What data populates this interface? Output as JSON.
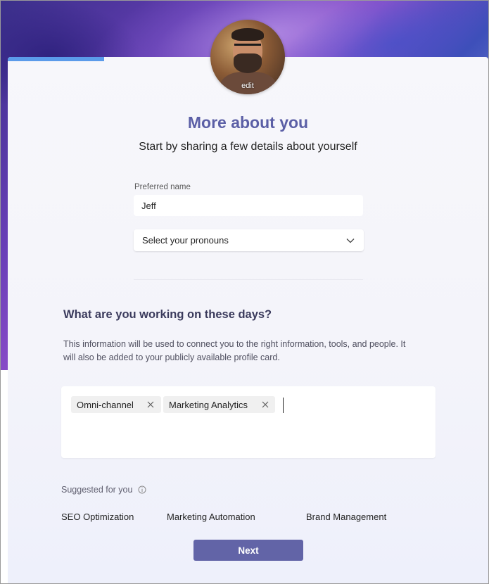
{
  "profile": {
    "avatar_edit_label": "edit",
    "progress_fraction": 0.2
  },
  "header": {
    "title": "More about you",
    "subtitle": "Start by sharing a few details about yourself"
  },
  "form": {
    "preferred_name_label": "Preferred name",
    "preferred_name_value": "Jeff",
    "pronouns_placeholder": "Select your pronouns"
  },
  "working_on": {
    "heading": "What are you working on these days?",
    "description": "This information will be used to connect you to the right information, tools, and people. It will also be added to your publicly available profile card.",
    "tags": [
      "Omni-channel",
      "Marketing Analytics"
    ]
  },
  "suggested": {
    "label": "Suggested for you",
    "items": [
      "SEO Optimization",
      "Marketing Automation",
      "Brand Management"
    ]
  },
  "actions": {
    "next_label": "Next"
  },
  "colors": {
    "accent": "#6264a7",
    "title": "#5b5fa6",
    "progress": "#5b9bea"
  }
}
